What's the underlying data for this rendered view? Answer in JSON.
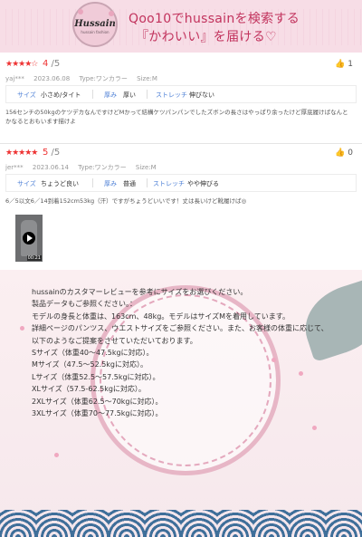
{
  "banner": {
    "logo_name": "Hussain",
    "logo_sub": "hussain fashion",
    "line1": "Qoo10でhussainを検索する",
    "line2": "『かわいい』を届ける♡",
    "bg_color": "#f7dde6",
    "text_color": "#c2335d"
  },
  "reviews": [
    {
      "stars": "★★★★☆",
      "score": "4",
      "score_max": " /5",
      "like_count": "1",
      "user": "yaj***",
      "date": "2023.06.08",
      "type": "Type:ワンカラー",
      "size": "Size:M",
      "fit": [
        {
          "label": "サイズ",
          "value": "小さめ/タイト"
        },
        {
          "label": "厚み",
          "value": "厚い"
        },
        {
          "label": "ストレッチ",
          "value": "伸びない"
        }
      ],
      "text": "156センチの50kgのケツデカなんですけどMかって結構ケツパンパンでしたズボンの長さはやっぱり余ったけど厚底履けばなんとかなるとおもいます描けよ"
    },
    {
      "stars": "★★★★★",
      "score": "5",
      "score_max": " /5",
      "like_count": "0",
      "user": "jer***",
      "date": "2023.06.14",
      "type": "Type:ワンカラー",
      "size": "Size:M",
      "fit": [
        {
          "label": "サイズ",
          "value": "ちょうど良い"
        },
        {
          "label": "厚み",
          "value": "普通"
        },
        {
          "label": "ストレッチ",
          "value": "やや伸びる"
        }
      ],
      "text": "6／5以文6／14到着152cm53kg（汗）ですがちょうどいいです！丈は長いけど靴履けば◎",
      "video_duration": "00:21"
    }
  ],
  "info": {
    "lines": [
      "hussainのカスタマーレビューを参考にサイズをお選びください。",
      "製品データもご参照ください。：",
      "モデルの身長と体重は、163cm、48kg。モデルはサイズMを着用しています。",
      "詳細ページのパンツス、ウエストサイズをご参照ください。また、お客様の体重に応じて、",
      "以下のようなご提案をさせていただいております。",
      "Sサイズ（体重40～47.5kgに対応）。",
      "Mサイズ（47.5～52.5kgに対応）。",
      "Lサイズ（体重52.5～57.5kgに対応）。",
      "XLサイズ（57.5-62.5kgに対応）。",
      "2XLサイズ（体重62.5～70kgに対応）。",
      "3XLサイズ（体重70～77.5kgに対応）。"
    ]
  },
  "colors": {
    "star": "#ee3333",
    "fit_label": "#4c7fd6",
    "accent_pink": "#e7b6c6"
  }
}
